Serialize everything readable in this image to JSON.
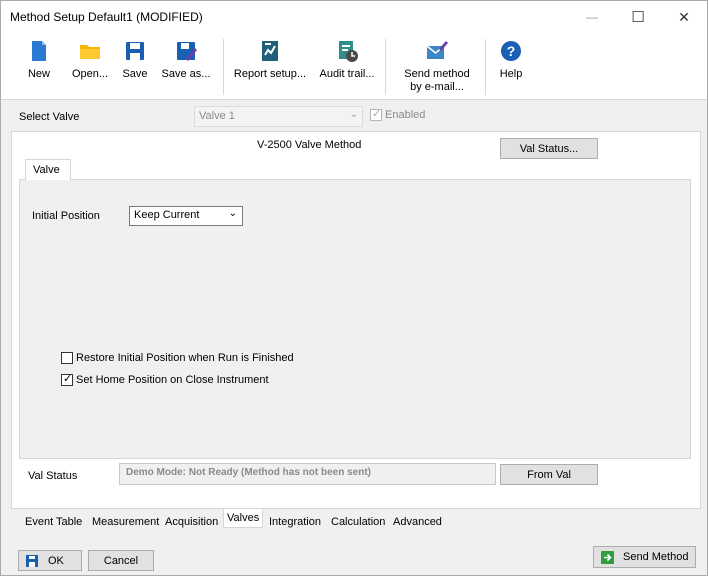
{
  "window": {
    "title": "Method Setup Default1 (MODIFIED)",
    "minimize": "—",
    "maximize": "☐",
    "close": "✕"
  },
  "toolbar": {
    "new": "New",
    "open": "Open...",
    "save": "Save",
    "save_as": "Save as...",
    "report_setup": "Report setup...",
    "audit_trail": "Audit trail...",
    "send_method": "Send method by e-mail...",
    "help": "Help"
  },
  "select_valve": {
    "label": "Select Valve",
    "value": "Valve 1",
    "enabled_label": "Enabled",
    "enabled_checked": true
  },
  "method": {
    "heading": "V-2500 Valve Method",
    "val_status_button": "Val Status..."
  },
  "valve_tab": {
    "label": "Valve",
    "initial_position_label": "Initial Position",
    "initial_position_value": "Keep Current",
    "restore_label": "Restore Initial Position when Run is Finished",
    "restore_checked": false,
    "home_label": "Set Home Position on Close Instrument",
    "home_checked": true
  },
  "status": {
    "label": "Val Status",
    "text": "Demo Mode: Not Ready (Method has not been sent)",
    "from_val_button": "From Val"
  },
  "bottom_tabs": [
    {
      "label": "Event Table",
      "active": false
    },
    {
      "label": "Measurement",
      "active": false
    },
    {
      "label": "Acquisition",
      "active": false
    },
    {
      "label": "Valves",
      "active": true
    },
    {
      "label": "Integration",
      "active": false
    },
    {
      "label": "Calculation",
      "active": false
    },
    {
      "label": "Advanced",
      "active": false
    }
  ],
  "footer": {
    "ok": "OK",
    "cancel": "Cancel",
    "send_method": "Send Method"
  },
  "colors": {
    "accent_blue": "#1a5fb4",
    "folder_yellow": "#f5b400",
    "send_green": "#2e9e3e"
  }
}
